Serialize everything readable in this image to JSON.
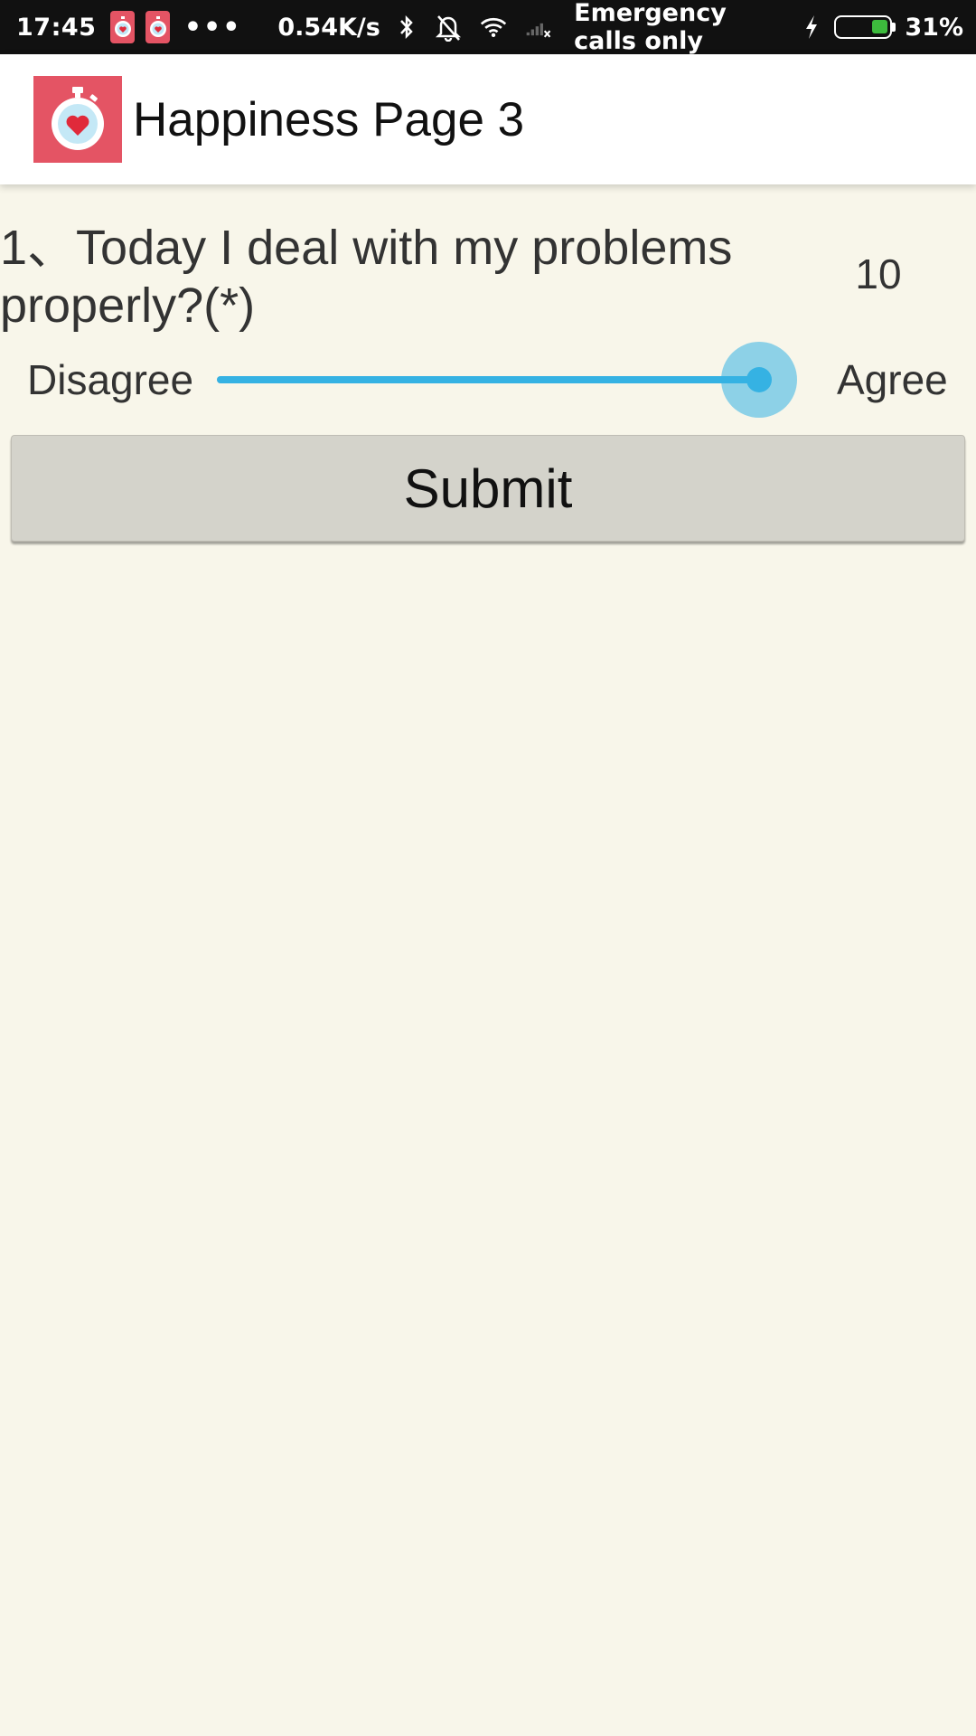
{
  "status_bar": {
    "time": "17:45",
    "overflow": "•••",
    "net_speed": "0.54K/s",
    "icons": [
      "timer-heart-icon",
      "timer-heart-icon",
      "bluetooth-icon",
      "bell-off-icon",
      "wifi-icon",
      "no-signal-icon",
      "charging-bolt-icon",
      "battery-icon"
    ],
    "carrier": "Emergency calls only",
    "battery_percent": "31%",
    "battery_level": 0.31,
    "battery_color": "#3dbb3d"
  },
  "app_bar": {
    "logo_icon": "stopwatch-heart-icon",
    "title": "Happiness Page 3",
    "logo_color": "#e45464"
  },
  "question": {
    "text": "1、Today I deal with my problems properly?(*)",
    "value": "10",
    "label_left": "Disagree",
    "label_right": "Agree",
    "slider_level": 1.0,
    "accent_color": "#35b2e3"
  },
  "submit": {
    "label": "Submit"
  }
}
